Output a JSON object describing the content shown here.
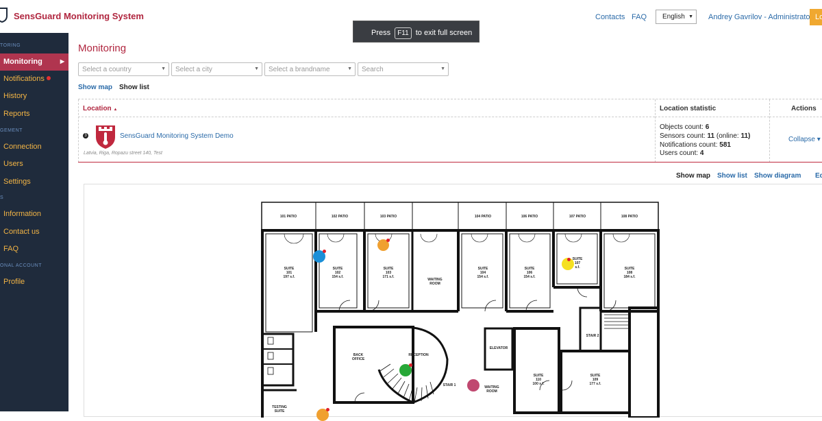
{
  "app": {
    "title": "SensGuard Monitoring System"
  },
  "header": {
    "contacts": "Contacts",
    "faq": "FAQ",
    "language": "English",
    "user": "Andrey Gavrilov - Administrator",
    "logout": "Log"
  },
  "toast": {
    "press": "Press",
    "key": "F11",
    "suffix": "to exit full screen"
  },
  "sidebar": {
    "sections": [
      "TORING",
      "GEMENT",
      "S",
      "ONAL ACCOUNT"
    ],
    "items": [
      {
        "label": "Monitoring",
        "active": true
      },
      {
        "label": "Notifications",
        "alert": true
      },
      {
        "label": "History"
      },
      {
        "label": "Reports"
      },
      {
        "label": "Connection"
      },
      {
        "label": "Users"
      },
      {
        "label": "Settings"
      },
      {
        "label": "Information"
      },
      {
        "label": "Contact us"
      },
      {
        "label": "FAQ"
      },
      {
        "label": "Profile"
      }
    ]
  },
  "main": {
    "title": "Monitoring",
    "filters": {
      "country": "Select a country",
      "city": "Select a city",
      "brand": "Select a brandname",
      "search": "Search"
    },
    "views": {
      "show_map": "Show map",
      "show_list": "Show list"
    },
    "table": {
      "headers": {
        "location": "Location",
        "sort": "▲",
        "statistic": "Location statistic",
        "actions": "Actions"
      },
      "row": {
        "badge": "3",
        "name": "SensGuard Monitoring System Demo",
        "address": "Latvia, Riga, Ropazu street 140, Test",
        "stats": {
          "objects_label": "Objects count:",
          "objects": "6",
          "sensors_label": "Sensors count:",
          "sensors": "11",
          "online_label": "(online:",
          "online": "11)",
          "notifications_label": "Notifications count:",
          "notifications": "581",
          "users_label": "Users count:",
          "users": "4"
        },
        "action": "Collapse ▾"
      }
    },
    "map_views": {
      "show_map": "Show map",
      "show_list": "Show list",
      "show_diagram": "Show diagram",
      "edit": "Ed"
    }
  },
  "floorplan": {
    "patios": [
      "101 PATIO",
      "102 PATIO",
      "103 PATIO",
      "104 PATIO",
      "106 PATIO",
      "107 PATIO",
      "108 PATIO"
    ],
    "suites": [
      {
        "line1": "SUITE",
        "line2": "101",
        "line3": "197 s.f."
      },
      {
        "line1": "SUITE",
        "line2": "102",
        "line3": "154 s.f."
      },
      {
        "line1": "SUITE",
        "line2": "103",
        "line3": "171 s.f."
      },
      {
        "line1": "SUITE",
        "line2": "104",
        "line3": "154 s.f."
      },
      {
        "line1": "SUITE",
        "line2": "106",
        "line3": "154 s.f."
      },
      {
        "line1": "SUITE",
        "line2": "107",
        "line3": "s.f."
      },
      {
        "line1": "SUITE",
        "line2": "108",
        "line3": "184 s.f."
      },
      {
        "line1": "SUITE",
        "line2": "110",
        "line3": "100 s.f."
      },
      {
        "line1": "SUITE",
        "line2": "109",
        "line3": "177 s.f."
      }
    ],
    "rooms": [
      "WAITING ROOM",
      "BACK OFFICE",
      "RECEPTION",
      "STAIR 1",
      "ELEVATOR",
      "STAIR 2",
      "WAITING ROOM",
      "TESTING SUITE"
    ],
    "sensor_colors": [
      "#1a8fd8",
      "#f0a030",
      "#f5e020",
      "#28a838",
      "#c04870",
      "#f0a030"
    ]
  }
}
